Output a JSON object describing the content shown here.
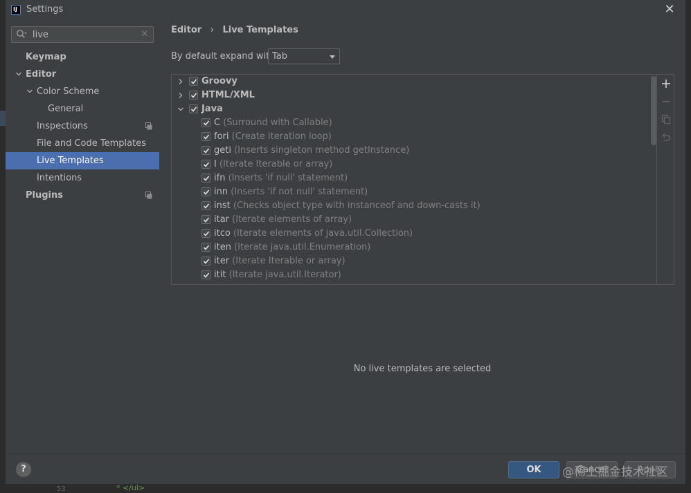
{
  "window": {
    "title": "Settings",
    "app_icon": "IJ"
  },
  "search": {
    "value": "live"
  },
  "nav": {
    "items": [
      {
        "label": "Keymap",
        "bold": true,
        "level": 0,
        "expander": ""
      },
      {
        "label": "Editor",
        "bold": true,
        "level": 0,
        "expander": "expanded"
      },
      {
        "label": "Color Scheme",
        "bold": false,
        "level": 1,
        "expander": "expanded"
      },
      {
        "label": "General",
        "bold": false,
        "level": 2,
        "expander": ""
      },
      {
        "label": "Inspections",
        "bold": false,
        "level": 1,
        "expander": "",
        "badge": true
      },
      {
        "label": "File and Code Templates",
        "bold": false,
        "level": 1,
        "expander": ""
      },
      {
        "label": "Live Templates",
        "bold": false,
        "level": 1,
        "expander": "",
        "selected": true
      },
      {
        "label": "Intentions",
        "bold": false,
        "level": 1,
        "expander": ""
      },
      {
        "label": "Plugins",
        "bold": true,
        "level": 0,
        "expander": "",
        "badge": true
      }
    ]
  },
  "breadcrumb": {
    "parent": "Editor",
    "separator": "›",
    "current": "Live Templates"
  },
  "expand": {
    "label": "By default expand with",
    "value": "Tab"
  },
  "tree": {
    "groups": [
      {
        "name": "Groovy",
        "expanded": false,
        "checked": true
      },
      {
        "name": "HTML/XML",
        "expanded": false,
        "checked": true
      },
      {
        "name": "Java",
        "expanded": true,
        "checked": true,
        "templates": [
          {
            "abbr": "C",
            "desc": "(Surround with Callable)"
          },
          {
            "abbr": "fori",
            "desc": "(Create iteration loop)"
          },
          {
            "abbr": "geti",
            "desc": "(Inserts singleton method getInstance)"
          },
          {
            "abbr": "I",
            "desc": "(Iterate Iterable or array)"
          },
          {
            "abbr": "ifn",
            "desc": "(Inserts 'if null' statement)"
          },
          {
            "abbr": "inn",
            "desc": "(Inserts 'if not null' statement)"
          },
          {
            "abbr": "inst",
            "desc": "(Checks object type with instanceof and down-casts it)"
          },
          {
            "abbr": "itar",
            "desc": "(Iterate elements of array)"
          },
          {
            "abbr": "itco",
            "desc": "(Iterate elements of java.util.Collection)"
          },
          {
            "abbr": "iten",
            "desc": "(Iterate java.util.Enumeration)"
          },
          {
            "abbr": "iter",
            "desc": "(Iterate Iterable or array)"
          },
          {
            "abbr": "itit",
            "desc": "(Iterate java.util.Iterator)"
          }
        ]
      }
    ]
  },
  "toolbar": {
    "icons": [
      "plus-icon",
      "minus-icon",
      "copy-icon",
      "restore-icon"
    ]
  },
  "empty_message": "No live templates are selected",
  "footer": {
    "help": "?",
    "ok": "OK",
    "cancel": "Cancel",
    "apply": "Apply"
  },
  "watermark": "@稀土掘金技术社区",
  "background_editor": {
    "line_number": "53",
    "code": "* </ul>"
  },
  "colors": {
    "selection": "#4b6eaf",
    "background": "#3c3f41",
    "ok_button": "#365880"
  }
}
